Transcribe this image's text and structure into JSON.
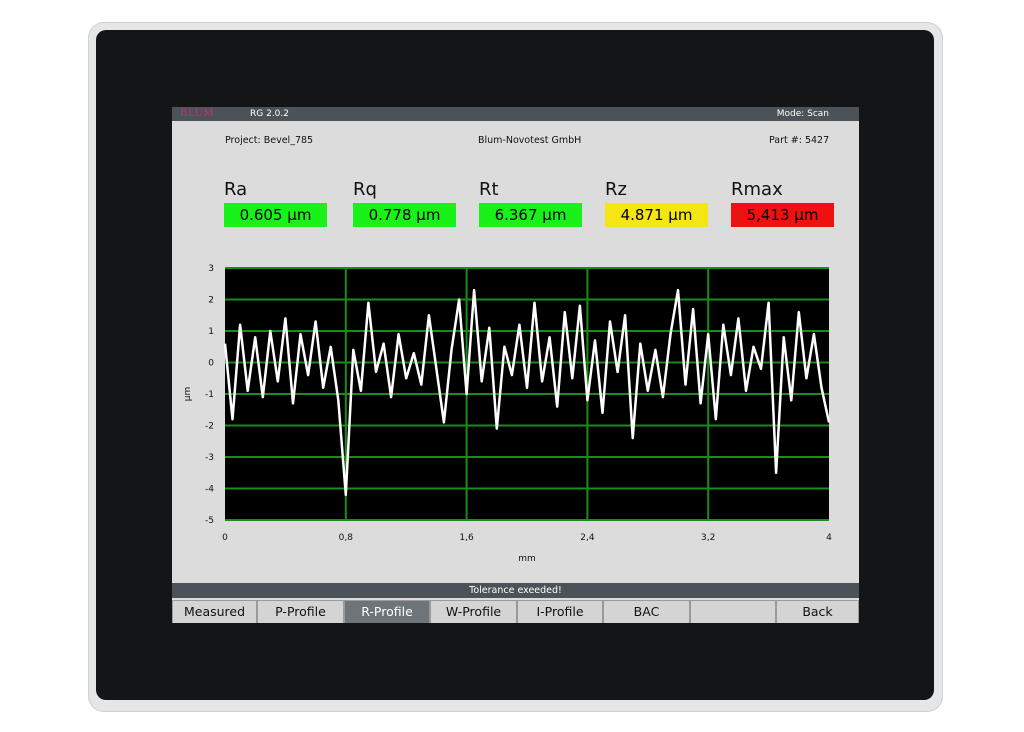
{
  "topbar": {
    "logo": "BLUM",
    "version": "RG 2.0.2",
    "mode": "Mode: Scan"
  },
  "header": {
    "project": "Project: Bevel_785",
    "company": "Blum-Novotest GmbH",
    "part": "Part #: 5427"
  },
  "metrics": [
    {
      "name": "Ra",
      "value": "0.605 µm",
      "color": "#19f219"
    },
    {
      "name": "Rq",
      "value": "0.778 µm",
      "color": "#19f219"
    },
    {
      "name": "Rt",
      "value": "6.367 µm",
      "color": "#19f219"
    },
    {
      "name": "Rz",
      "value": "4.871 µm",
      "color": "#f5e512"
    },
    {
      "name": "Rmax",
      "value": "5,413 µm",
      "color": "#f01010"
    }
  ],
  "chart_data": {
    "type": "line",
    "xlabel": "mm",
    "ylabel": "µm",
    "xlim": [
      0,
      4
    ],
    "ylim": [
      -5,
      3
    ],
    "x_ticks": [
      "0",
      "0,8",
      "1,6",
      "2,4",
      "3,2",
      "4"
    ],
    "y_ticks": [
      "3",
      "2",
      "1",
      "0",
      "-1",
      "-2",
      "-3",
      "-4",
      "-5"
    ],
    "background": "#000000",
    "grid_color": "#1a8c1a",
    "line_color": "#ffffff",
    "series": [
      {
        "x": [
          0,
          0.05,
          0.1,
          0.15,
          0.2,
          0.25,
          0.3,
          0.35,
          0.4,
          0.45,
          0.5,
          0.55,
          0.6,
          0.65,
          0.7,
          0.75,
          0.8,
          0.85,
          0.9,
          0.95,
          1.0,
          1.05,
          1.1,
          1.15,
          1.2,
          1.25,
          1.3,
          1.35,
          1.4,
          1.45,
          1.5,
          1.55,
          1.6,
          1.65,
          1.7,
          1.75,
          1.8,
          1.85,
          1.9,
          1.95,
          2.0,
          2.05,
          2.1,
          2.15,
          2.2,
          2.25,
          2.3,
          2.35,
          2.4,
          2.45,
          2.5,
          2.55,
          2.6,
          2.65,
          2.7,
          2.75,
          2.8,
          2.85,
          2.9,
          2.95,
          3.0,
          3.05,
          3.1,
          3.15,
          3.2,
          3.25,
          3.3,
          3.35,
          3.4,
          3.45,
          3.5,
          3.55,
          3.6,
          3.65,
          3.7,
          3.75,
          3.8,
          3.85,
          3.9,
          3.95,
          4.0
        ],
        "y": [
          0.6,
          -1.8,
          1.2,
          -0.9,
          0.8,
          -1.1,
          1.0,
          -0.6,
          1.4,
          -1.3,
          0.9,
          -0.4,
          1.3,
          -0.8,
          0.5,
          -1.2,
          -4.2,
          0.4,
          -0.9,
          1.9,
          -0.3,
          0.6,
          -1.1,
          0.9,
          -0.5,
          0.3,
          -0.7,
          1.5,
          -0.2,
          -1.9,
          0.4,
          2.0,
          -1.0,
          2.3,
          -0.6,
          1.1,
          -2.1,
          0.5,
          -0.4,
          1.2,
          -0.8,
          1.9,
          -0.6,
          0.8,
          -1.4,
          1.6,
          -0.5,
          1.8,
          -1.2,
          0.7,
          -1.6,
          1.3,
          -0.3,
          1.5,
          -2.4,
          0.6,
          -0.9,
          0.4,
          -1.1,
          0.9,
          2.3,
          -0.7,
          1.7,
          -1.3,
          0.9,
          -1.8,
          1.2,
          -0.4,
          1.4,
          -0.9,
          0.5,
          -0.2,
          1.9,
          -3.5,
          0.8,
          -1.2,
          1.6,
          -0.5,
          0.9,
          -0.8,
          -1.9
        ]
      }
    ]
  },
  "status": {
    "text": "Tolerance exeeded!"
  },
  "buttons": [
    {
      "label": "Measured"
    },
    {
      "label": "P-Profile"
    },
    {
      "label": "R-Profile"
    },
    {
      "label": "W-Profile"
    },
    {
      "label": "I-Profile"
    },
    {
      "label": "BAC"
    },
    {
      "label": ""
    },
    {
      "label": "Back"
    }
  ]
}
